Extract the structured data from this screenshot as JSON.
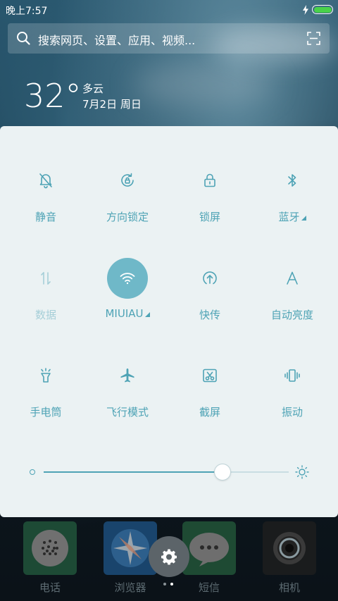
{
  "status_bar": {
    "time": "晚上7:57",
    "battery_level": 1.0
  },
  "search": {
    "placeholder": "搜索网页、设置、应用、视频..."
  },
  "weather": {
    "temperature": "32°",
    "condition": "多云",
    "date": "7月2日 周日"
  },
  "quick_settings": {
    "tiles": [
      {
        "label": "静音",
        "icon": "bell-off-icon",
        "state": "off"
      },
      {
        "label": "方向锁定",
        "icon": "rotation-lock-icon",
        "state": "off"
      },
      {
        "label": "锁屏",
        "icon": "lock-icon",
        "state": "off"
      },
      {
        "label": "蓝牙",
        "icon": "bluetooth-icon",
        "state": "off",
        "expandable": true
      },
      {
        "label": "数据",
        "icon": "mobile-data-icon",
        "state": "disabled"
      },
      {
        "label": "MIUIAU",
        "icon": "wifi-icon",
        "state": "on",
        "expandable": true
      },
      {
        "label": "快传",
        "icon": "share-upload-icon",
        "state": "off"
      },
      {
        "label": "自动亮度",
        "icon": "auto-brightness-icon",
        "state": "off"
      },
      {
        "label": "手电筒",
        "icon": "flashlight-icon",
        "state": "off"
      },
      {
        "label": "飞行模式",
        "icon": "airplane-icon",
        "state": "off"
      },
      {
        "label": "截屏",
        "icon": "screenshot-icon",
        "state": "off"
      },
      {
        "label": "振动",
        "icon": "vibrate-icon",
        "state": "off"
      }
    ],
    "brightness_level": 0.73
  },
  "dock": {
    "apps": [
      {
        "label": "电话",
        "icon": "phone-app-icon"
      },
      {
        "label": "浏览器",
        "icon": "browser-app-icon"
      },
      {
        "label": "短信",
        "icon": "messages-app-icon"
      },
      {
        "label": "相机",
        "icon": "camera-app-icon"
      }
    ],
    "settings_icon": "gear-icon",
    "page_count": 2,
    "current_page": 2
  },
  "colors": {
    "accent": "#4ea3b5",
    "active_tile": "#6fb8c8",
    "panel_bg": "#ebf2f3",
    "battery_green": "#49d24a"
  }
}
